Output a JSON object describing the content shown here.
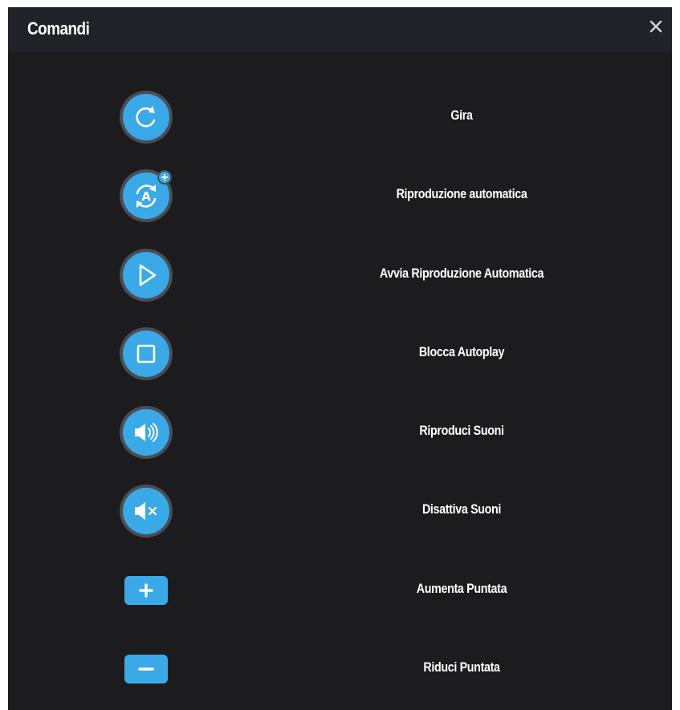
{
  "dialog": {
    "title": "Comandi",
    "close_icon": "close-icon"
  },
  "colors": {
    "panel_bg": "#1c1c1e",
    "header_bg": "#202227",
    "accent_blue": "#3aa9e8",
    "ring_gray": "#4a4d54",
    "text": "#ffffff"
  },
  "commands": [
    {
      "icon": "spin-icon",
      "label": "Gira"
    },
    {
      "icon": "autoplay-settings-icon",
      "label": "Riproduzione automatica"
    },
    {
      "icon": "play-icon",
      "label": "Avvia Riproduzione Automatica"
    },
    {
      "icon": "stop-icon",
      "label": "Blocca Autoplay"
    },
    {
      "icon": "sound-on-icon",
      "label": "Riproduci Suoni"
    },
    {
      "icon": "sound-off-icon",
      "label": "Disattiva Suoni"
    },
    {
      "icon": "plus-icon",
      "label": "Aumenta Puntata"
    },
    {
      "icon": "minus-icon",
      "label": "Riduci Puntata"
    }
  ]
}
